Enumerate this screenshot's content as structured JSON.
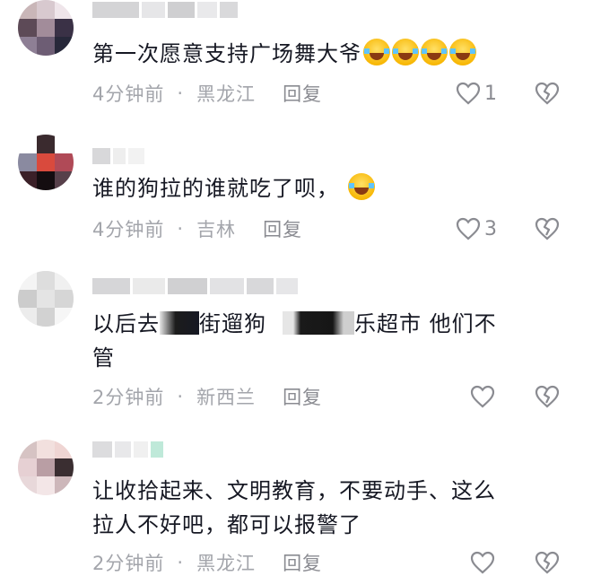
{
  "comments": [
    {
      "text": "第一次愿意支持广场舞大爷",
      "emoji_count": 4,
      "time": "4分钟前",
      "location": "黑龙江",
      "reply_label": "回复",
      "likes": "1"
    },
    {
      "text": "谁的狗拉的谁就吃了呗，",
      "emoji_count": 1,
      "time": "4分钟前",
      "location": "吉林",
      "reply_label": "回复",
      "likes": "3"
    },
    {
      "text_parts": [
        "以后去",
        "街遛狗",
        "乐超市  他们不",
        "管"
      ],
      "time": "2分钟前",
      "location": "新西兰",
      "reply_label": "回复",
      "likes": ""
    },
    {
      "text_lines": [
        "让收拾起来、文明教育，不要动手、这么",
        "拉人不好吧，都可以报警了"
      ],
      "time": "2分钟前",
      "location": "黑龙江",
      "reply_label": "回复",
      "likes": ""
    }
  ],
  "separator": "·",
  "icons": {
    "like": "heart-outline-icon",
    "dislike": "broken-heart-icon",
    "emoji": "laughing-tears-emoji"
  },
  "colors": {
    "text": "#161823",
    "meta": "#a3a5ab",
    "icon": "#8a8b91"
  }
}
